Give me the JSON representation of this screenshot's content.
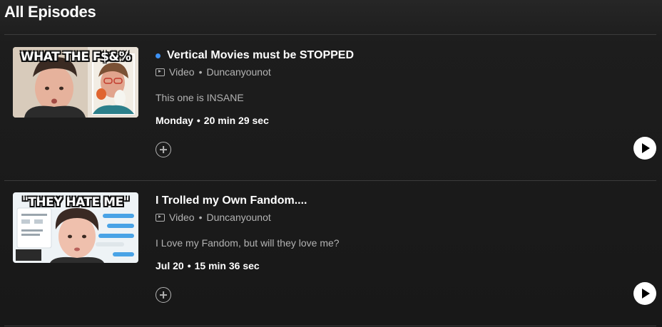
{
  "section": {
    "title": "All Episodes"
  },
  "episodes": [
    {
      "title": "Vertical Movies must be STOPPED",
      "is_new": true,
      "type": "Video",
      "separator": "•",
      "channel": "Duncanyounot",
      "description": "This one is INSANE",
      "date": "Monday",
      "duration": "20 min 29 sec",
      "thumbnail_caption": "WHAT THE F$&%",
      "add_icon": "plus-circle-icon",
      "play_icon": "play-icon"
    },
    {
      "title": "I Trolled my Own Fandom....",
      "is_new": false,
      "type": "Video",
      "separator": "•",
      "channel": "Duncanyounot",
      "description": "I Love my Fandom, but will they love me?",
      "date": "Jul 20",
      "duration": "15 min 36 sec",
      "thumbnail_caption": "\"THEY HATE ME\"",
      "add_icon": "plus-circle-icon",
      "play_icon": "play-icon"
    }
  ],
  "colors": {
    "background": "#1d1d1d",
    "text_primary": "#ffffff",
    "text_secondary": "#b3b3b3",
    "new_dot": "#3d91f4",
    "divider": "#3b3b3b"
  }
}
